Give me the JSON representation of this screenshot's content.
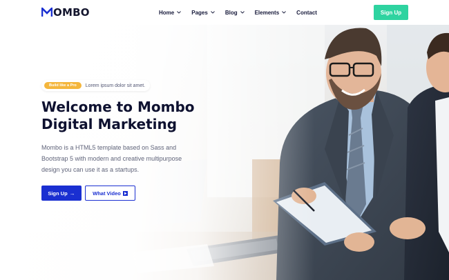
{
  "brand": {
    "name": "MOMBO",
    "logo_letters": "OMBO",
    "accent": "#1a2fd1"
  },
  "nav": {
    "items": [
      {
        "label": "Home",
        "has_dropdown": true
      },
      {
        "label": "Pages",
        "has_dropdown": true
      },
      {
        "label": "Blog",
        "has_dropdown": true
      },
      {
        "label": "Elements",
        "has_dropdown": true
      },
      {
        "label": "Contact",
        "has_dropdown": false
      }
    ],
    "signup_label": "Sign Up",
    "signup_color": "#2ed3a0"
  },
  "hero": {
    "badge_label": "Build like a Pro",
    "badge_text": "Lorem ipsum dolor sit amet.",
    "badge_color": "#f4b63c",
    "title_line1": "Welcome to Mombo",
    "title_line2": "Digital Marketing",
    "description": "Mombo is a HTML5 template based on Sass and Bootstrap 5 with modern and creative multipurpose design you can use it as a startups.",
    "primary_button": "Sign Up",
    "primary_icon": "arrow-right-icon",
    "secondary_button": "What Video",
    "secondary_icon": "play-icon"
  }
}
